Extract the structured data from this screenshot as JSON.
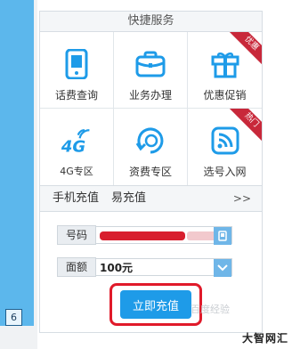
{
  "sidebar": {
    "page_number": "6"
  },
  "panel": {
    "header": "快捷服务",
    "services": [
      {
        "label": "话费查询",
        "icon": "phone-icon",
        "badge": ""
      },
      {
        "label": "业务办理",
        "icon": "briefcase-icon",
        "badge": ""
      },
      {
        "label": "优惠促销",
        "icon": "gift-icon",
        "badge": "优惠"
      },
      {
        "label": "4G专区",
        "icon": "4g-icon",
        "badge": ""
      },
      {
        "label": "资费专区",
        "icon": "refresh-coin-icon",
        "badge": ""
      },
      {
        "label": "选号入网",
        "icon": "signal-icon",
        "badge": "热门"
      }
    ],
    "recharge": {
      "title": "手机充值",
      "tab": "易充值",
      "more": ">>",
      "phone_label": "号码",
      "phone_value": "",
      "amount_label": "面额",
      "amount_value": "100元",
      "submit_label": "立即充值"
    }
  },
  "watermark": "大智网汇",
  "faint_watermark": "百度经验",
  "colors": {
    "icon": "#1e9be8",
    "badge": "#c8283a",
    "submit": "#1e9be8",
    "highlight": "#e01a2a"
  }
}
